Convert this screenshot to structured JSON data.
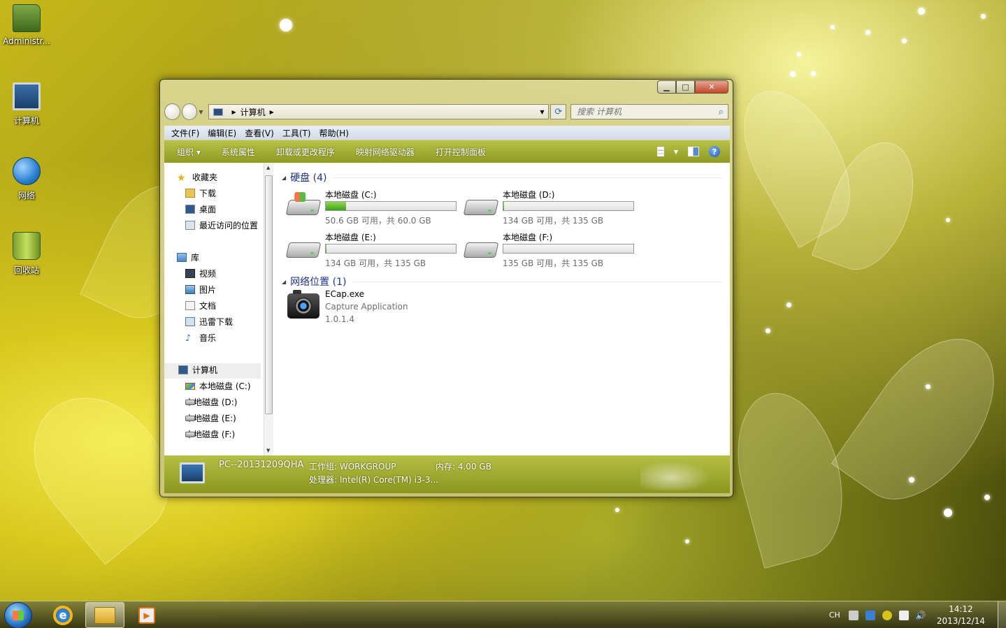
{
  "desktop": {
    "icons": [
      {
        "label": "Administr..."
      },
      {
        "label": "计算机"
      },
      {
        "label": "网络"
      },
      {
        "label": "回收站"
      }
    ]
  },
  "window": {
    "address": {
      "crumb": "计算机"
    },
    "search": {
      "placeholder": "搜索 计算机"
    },
    "menu": [
      "文件(F)",
      "编辑(E)",
      "查看(V)",
      "工具(T)",
      "帮助(H)"
    ],
    "toolbar": [
      "组织 ▾",
      "系统属性",
      "卸载或更改程序",
      "映射网络驱动器",
      "打开控制面板"
    ],
    "nav": {
      "favorites": "收藏夹",
      "favorites_items": [
        "下载",
        "桌面",
        "最近访问的位置"
      ],
      "libraries": "库",
      "library_items": [
        "视频",
        "图片",
        "文档",
        "迅雷下载",
        "音乐"
      ],
      "computer": "计算机",
      "drive_items": [
        "本地磁盘 (C:)",
        "本地磁盘 (D:)",
        "本地磁盘 (E:)",
        "本地磁盘 (F:)"
      ]
    },
    "groups": {
      "hard_disks": "硬盘 (4)",
      "network": "网络位置 (1)"
    },
    "drives": [
      {
        "name": "本地磁盘 (C:)",
        "info": "50.6 GB 可用，共 60.0 GB",
        "used_fraction": 0.157
      },
      {
        "name": "本地磁盘 (D:)",
        "info": "134 GB 可用，共 135 GB",
        "used_fraction": 0.007
      },
      {
        "name": "本地磁盘 (E:)",
        "info": "134 GB 可用，共 135 GB",
        "used_fraction": 0.007
      },
      {
        "name": "本地磁盘 (F:)",
        "info": "135 GB 可用，共 135 GB",
        "used_fraction": 0.0
      }
    ],
    "network_item": {
      "name": "ECap.exe",
      "description": "Capture Application",
      "version": "1.0.1.4"
    },
    "details": {
      "pc_name": "PC--20131209QHA",
      "workgroup": "工作组: WORKGROUP",
      "memory": "内存: 4.00 GB",
      "processor": "处理器: Intel(R) Core(TM) i3-3..."
    }
  },
  "taskbar": {
    "lang": "CH",
    "time": "14:12",
    "date": "2013/12/14"
  },
  "colors": {
    "accent_toolbar": "#9aa42c",
    "drive_fill": "#3ea11b",
    "group_header": "#1e3287"
  }
}
